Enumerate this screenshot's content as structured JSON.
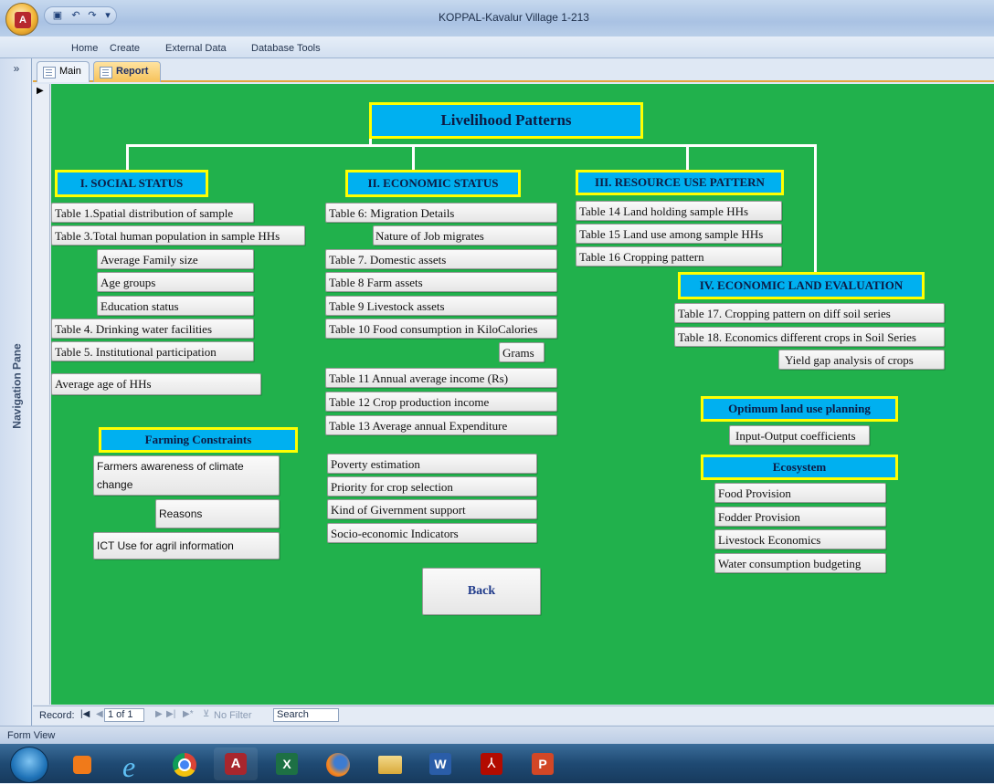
{
  "window": {
    "title": "KOPPAL-Kavalur Village 1-213"
  },
  "ribbon": {
    "tabs": [
      "Home",
      "Create",
      "External Data",
      "Database Tools"
    ]
  },
  "nav": {
    "toggle": "»",
    "label": "Navigation Pane"
  },
  "doc_tabs": [
    {
      "label": "Main"
    },
    {
      "label": "Report"
    }
  ],
  "report": {
    "title": "Livelihood Patterns",
    "social": {
      "header": "I. SOCIAL STATUS",
      "items": [
        "Table 1.Spatial distribution of sample",
        "Table 3.Total human population in sample HHs",
        "Average Family size",
        "Age groups",
        "Education status",
        "Table 4. Drinking water facilities",
        "Table 5. Institutional participation",
        "Average age of HHs"
      ]
    },
    "farming": {
      "header": "Farming Constraints",
      "items": [
        "Farmers awareness of climate change",
        "Reasons",
        "ICT Use for agril information"
      ]
    },
    "economic": {
      "header": "II. ECONOMIC STATUS",
      "items": [
        "Table 6: Migration Details",
        "Nature of Job migrates",
        "Table 7. Domestic assets",
        "Table 8 Farm assets",
        "Table 9 Livestock assets",
        "Table 10 Food consumption in KiloCalories",
        "Grams",
        "Table 11 Annual average income (Rs)",
        "Table 12 Crop production income",
        "Table 13 Average annual Expenditure",
        "Poverty estimation",
        "Priority for crop selection",
        "Kind of Givernment support",
        "Socio-economic Indicators"
      ]
    },
    "resource": {
      "header": "III. RESOURCE USE PATTERN",
      "items": [
        "Table 14 Land holding sample HHs",
        "Table 15 Land use among sample HHs",
        "Table 16 Cropping pattern"
      ]
    },
    "land_eval": {
      "header": "IV. ECONOMIC LAND EVALUATION",
      "items": [
        "Table 17. Cropping pattern on diff soil series",
        "Table 18. Economics different crops in  Soil Series",
        "Yield gap analysis of crops"
      ]
    },
    "optimum": {
      "header": "Optimum land use planning",
      "items": [
        "Input-Output coefficients"
      ]
    },
    "ecosystem": {
      "header": "Ecosystem",
      "items": [
        "Food Provision",
        "Fodder Provision",
        "Livestock Economics",
        "Water consumption budgeting"
      ]
    },
    "back": "Back"
  },
  "record_bar": {
    "label": "Record:",
    "position": "1 of 1",
    "filter": "No Filter",
    "search": "Search"
  },
  "status": {
    "view": "Form View"
  },
  "taskbar": {
    "icons": [
      "start-orb",
      "media-player",
      "internet-explorer",
      "chrome",
      "access",
      "excel",
      "firefox",
      "file-explorer",
      "word",
      "acrobat",
      "powerpoint"
    ]
  }
}
